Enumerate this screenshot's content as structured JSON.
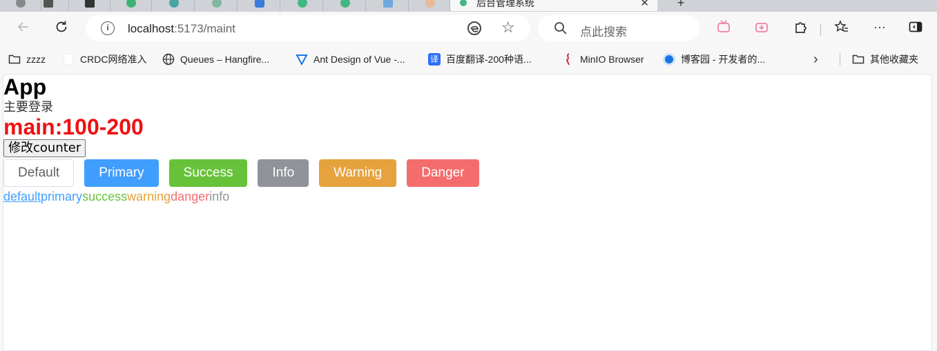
{
  "browser": {
    "active_tab": {
      "title": "后台管理系统"
    },
    "address": {
      "host": "localhost",
      "path": ":5173/maint"
    },
    "search": {
      "placeholder": "点此搜索"
    }
  },
  "bookmarks": [
    {
      "label": "zzzz",
      "icon": "folder-icon"
    },
    {
      "label": "CRDC网络准入",
      "icon": "blank-page-icon"
    },
    {
      "label": "Queues – Hangfire...",
      "icon": "globe-icon"
    },
    {
      "label": "Ant Design of Vue -...",
      "icon": "ant-design-icon"
    },
    {
      "label": "百度翻译-200种语...",
      "icon": "translate-icon"
    },
    {
      "label": "MinIO Browser",
      "icon": "minio-icon"
    },
    {
      "label": "博客园 - 开发者的...",
      "icon": "cnblogs-icon"
    }
  ],
  "bookmarks_other": {
    "label": "其他收藏夹"
  },
  "page": {
    "heading": "App",
    "subtitle": "主要登录",
    "counter_text": "main:100-200",
    "modify_button": "修改counter",
    "buttons": [
      {
        "label": "Default",
        "type": "default"
      },
      {
        "label": "Primary",
        "type": "primary"
      },
      {
        "label": "Success",
        "type": "success"
      },
      {
        "label": "Info",
        "type": "info"
      },
      {
        "label": "Warning",
        "type": "warning"
      },
      {
        "label": "Danger",
        "type": "danger"
      }
    ],
    "links": [
      {
        "label": "default",
        "type": "default"
      },
      {
        "label": "primary",
        "type": "primary"
      },
      {
        "label": "success",
        "type": "success"
      },
      {
        "label": "warning",
        "type": "warning"
      },
      {
        "label": "danger",
        "type": "danger"
      },
      {
        "label": "info",
        "type": "info"
      }
    ]
  },
  "colors": {
    "primary": "#409eff",
    "success": "#67c23a",
    "info": "#909399",
    "warning": "#e6a23c",
    "danger": "#f56c6c",
    "counter": "#ee1111"
  }
}
